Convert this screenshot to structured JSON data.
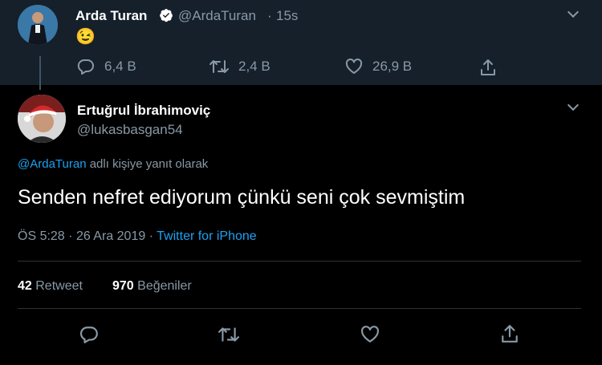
{
  "parent_tweet": {
    "name": "Arda Turan",
    "handle": "@ArdaTuran",
    "time": "15s",
    "emoji": "😉",
    "reply_count": "6,4 B",
    "retweet_count": "2,4 B",
    "like_count": "26,9 B"
  },
  "main_tweet": {
    "name": "Ertuğrul İbrahimoviç",
    "handle": "@lukasbasgan54",
    "reply_to_handle": "@ArdaTuran",
    "reply_to_suffix": "adlı kişiye yanıt olarak",
    "text": "Senden nefret ediyorum çünkü seni çok sevmiştim",
    "time": "ÖS 5:28",
    "date": "26 Ara 2019",
    "source": "Twitter for iPhone",
    "retweets_count": "42",
    "retweets_label": "Retweet",
    "likes_count": "970",
    "likes_label": "Beğeniler"
  },
  "colors": {
    "accent": "#1da1f2",
    "muted": "#8899a6",
    "parent_bg": "#15202b",
    "bg": "#000000"
  }
}
